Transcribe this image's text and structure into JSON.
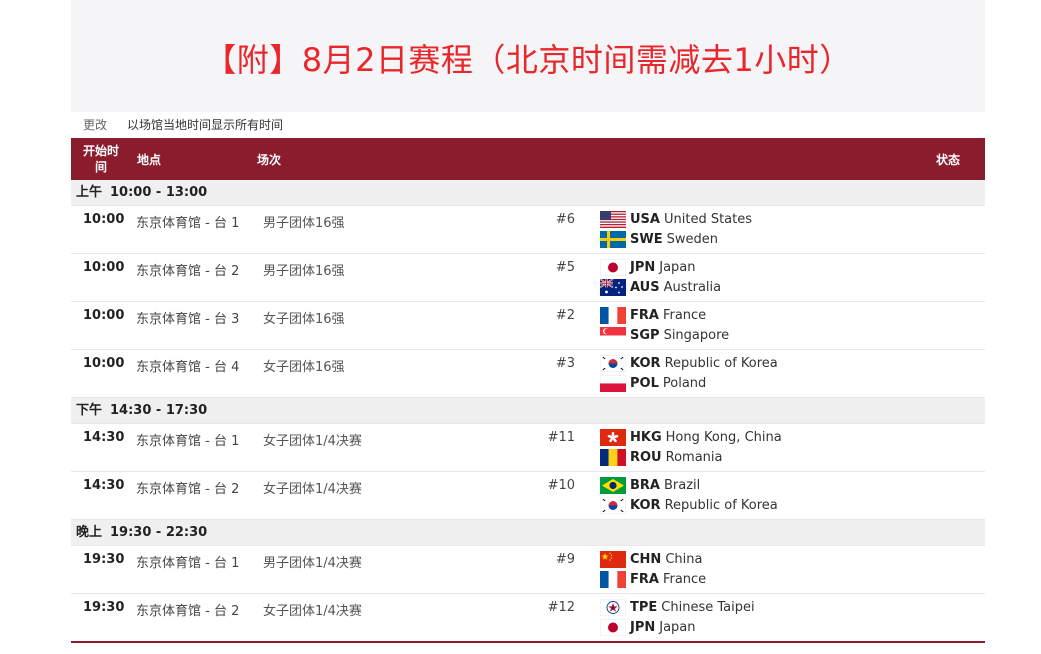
{
  "title": "【附】8月2日赛程（北京时间需减去1小时）",
  "subbar": {
    "change": "更改",
    "toggle": "以场馆当地时间显示所有时间"
  },
  "header": {
    "time": "开始时间",
    "venue": "地点",
    "event": "场次",
    "status": "状态"
  },
  "groups": [
    {
      "label": "上午",
      "range": "10:00 - 13:00"
    },
    {
      "label": "下午",
      "range": "14:30 - 17:30"
    },
    {
      "label": "晚上",
      "range": "19:30 - 22:30"
    }
  ],
  "matches": [
    {
      "time": "10:00",
      "venue": "东京体育馆 - 台 1",
      "event": "男子团体16强",
      "match": "#6",
      "t1": {
        "code": "USA",
        "name": "United States",
        "flag": "usa-flag"
      },
      "t2": {
        "code": "SWE",
        "name": "Sweden",
        "flag": "swe-flag"
      }
    },
    {
      "time": "10:00",
      "venue": "东京体育馆 - 台 2",
      "event": "男子团体16强",
      "match": "#5",
      "t1": {
        "code": "JPN",
        "name": "Japan",
        "flag": "jpn-flag"
      },
      "t2": {
        "code": "AUS",
        "name": "Australia",
        "flag": "aus-flag"
      }
    },
    {
      "time": "10:00",
      "venue": "东京体育馆 - 台 3",
      "event": "女子团体16强",
      "match": "#2",
      "t1": {
        "code": "FRA",
        "name": "France",
        "flag": "fra-flag"
      },
      "t2": {
        "code": "SGP",
        "name": "Singapore",
        "flag": "sgp-flag"
      }
    },
    {
      "time": "10:00",
      "venue": "东京体育馆 - 台 4",
      "event": "女子团体16强",
      "match": "#3",
      "t1": {
        "code": "KOR",
        "name": "Republic of Korea",
        "flag": "kor-flag"
      },
      "t2": {
        "code": "POL",
        "name": "Poland",
        "flag": "pol-flag"
      }
    },
    {
      "time": "14:30",
      "venue": "东京体育馆 - 台 1",
      "event": "女子团体1/4决赛",
      "match": "#11",
      "t1": {
        "code": "HKG",
        "name": "Hong Kong, China",
        "flag": "hkg-flag"
      },
      "t2": {
        "code": "ROU",
        "name": "Romania",
        "flag": "rou-flag"
      }
    },
    {
      "time": "14:30",
      "venue": "东京体育馆 - 台 2",
      "event": "女子团体1/4决赛",
      "match": "#10",
      "t1": {
        "code": "BRA",
        "name": "Brazil",
        "flag": "bra-flag"
      },
      "t2": {
        "code": "KOR",
        "name": "Republic of Korea",
        "flag": "kor-flag"
      }
    },
    {
      "time": "19:30",
      "venue": "东京体育馆 - 台 1",
      "event": "男子团体1/4决赛",
      "match": "#9",
      "t1": {
        "code": "CHN",
        "name": "China",
        "flag": "chn-flag"
      },
      "t2": {
        "code": "FRA",
        "name": "France",
        "flag": "fra-flag"
      }
    },
    {
      "time": "19:30",
      "venue": "东京体育馆 - 台 2",
      "event": "女子团体1/4决赛",
      "match": "#12",
      "t1": {
        "code": "TPE",
        "name": "Chinese Taipei",
        "flag": "tpe-flag"
      },
      "t2": {
        "code": "JPN",
        "name": "Japan",
        "flag": "jpn-flag"
      }
    }
  ]
}
